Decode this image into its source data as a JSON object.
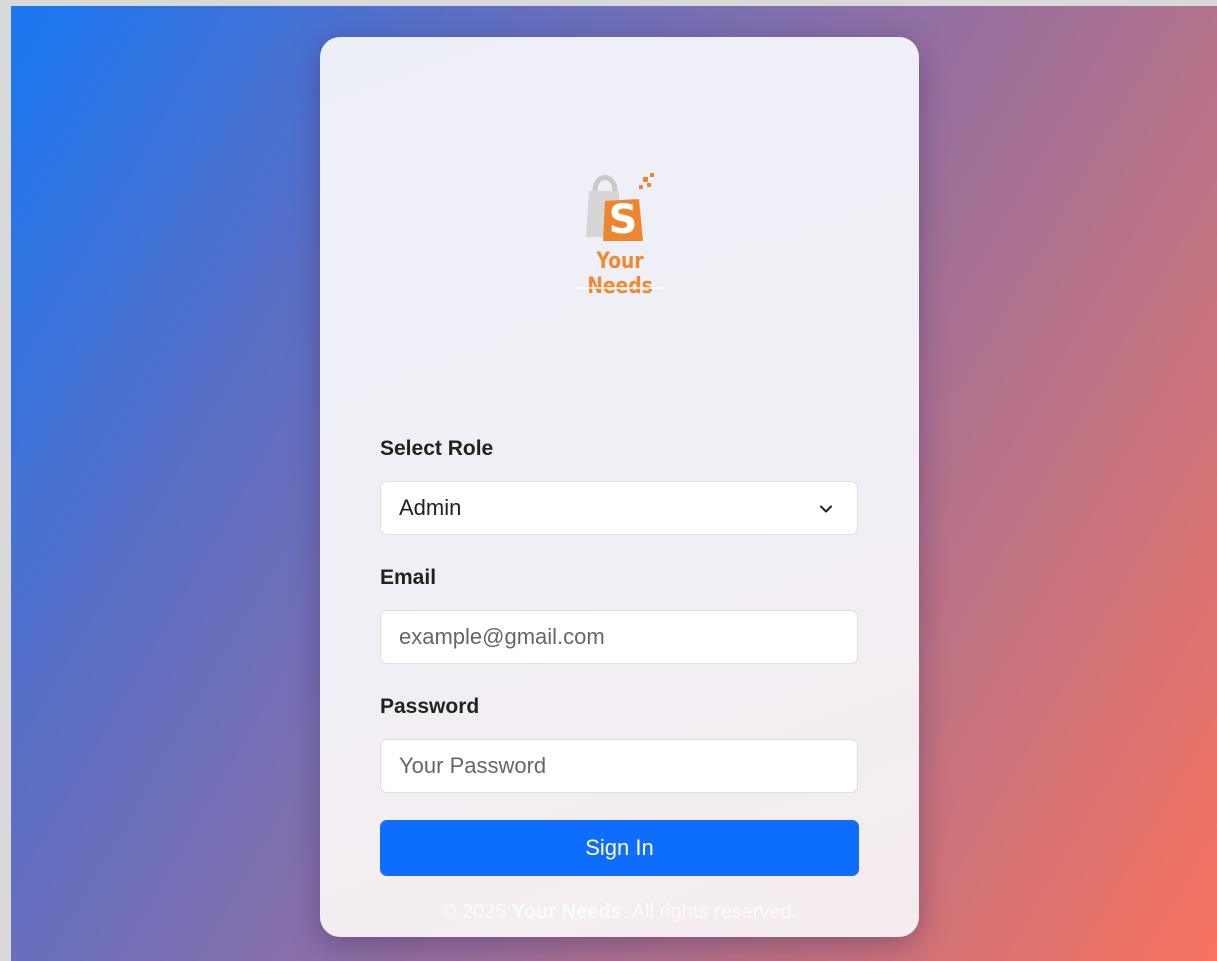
{
  "brand": {
    "name": "Your Needs",
    "logo_letter": "S",
    "primary_color": "#ef8a30",
    "button_color": "#0d6efd"
  },
  "form": {
    "role": {
      "label": "Select Role",
      "selected": "Admin",
      "icon": "chevron-down-icon"
    },
    "email": {
      "label": "Email",
      "value": "",
      "placeholder": "example@gmail.com"
    },
    "password": {
      "label": "Password",
      "value": "",
      "placeholder": "Your Password"
    },
    "submit_label": "Sign In"
  },
  "footer": {
    "prefix": "© 2025 ",
    "brand": "Your Needs",
    "suffix": ". All rights reserved."
  }
}
